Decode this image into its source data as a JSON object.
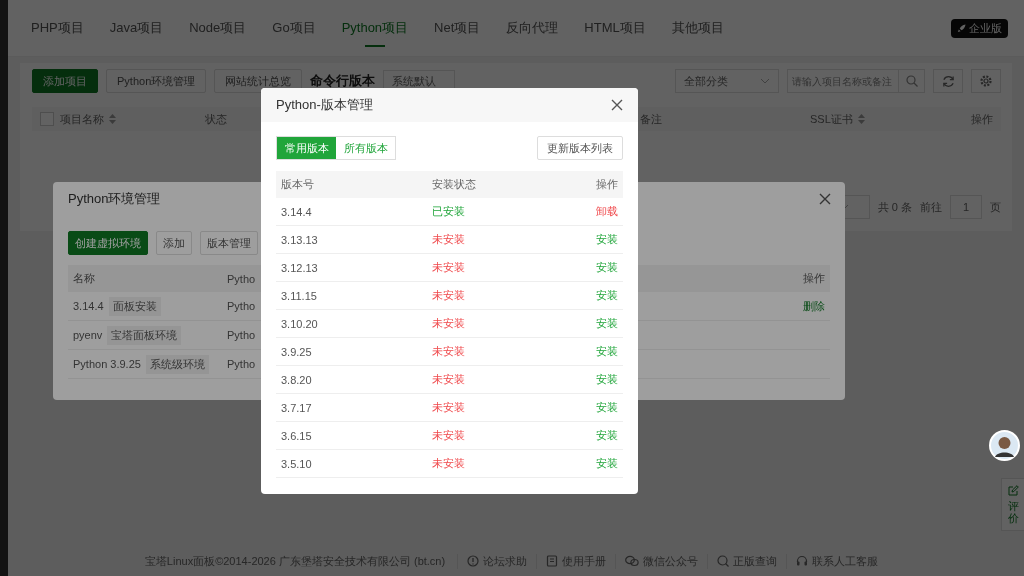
{
  "project_tabs": [
    {
      "label": "PHP项目",
      "selected": false
    },
    {
      "label": "Java项目",
      "selected": false
    },
    {
      "label": "Node项目",
      "selected": false
    },
    {
      "label": "Go项目",
      "selected": false
    },
    {
      "label": "Python项目",
      "selected": true
    },
    {
      "label": "Net项目",
      "selected": false
    },
    {
      "label": "反向代理",
      "selected": false
    },
    {
      "label": "HTML项目",
      "selected": false
    },
    {
      "label": "其他项目",
      "selected": false
    }
  ],
  "edition_badge": "企业版",
  "toolbar": {
    "buttons": [
      {
        "label": "添加项目",
        "kind": "primary"
      },
      {
        "label": "Python环境管理",
        "kind": "default"
      },
      {
        "label": "网站统计总览",
        "kind": "default"
      }
    ],
    "cli_version_label": "命令行版本",
    "cli_version_select": "系统默认",
    "category_select": "全部分类",
    "search": {
      "placeholder": "请输入项目名称或备注"
    }
  },
  "project_table": {
    "select_all": {
      "checked": false
    },
    "columns": [
      {
        "label": "项目名称",
        "sortable": true
      },
      {
        "label": "状态",
        "sortable": false
      },
      {
        "label": "备注",
        "sortable": false
      },
      {
        "label": "SSL证书",
        "sortable": true
      },
      {
        "label": "操作",
        "sortable": false
      }
    ]
  },
  "pagination": {
    "total": "共 0 条",
    "goto_label": "前往",
    "page": "1",
    "page_unit": "页"
  },
  "footer": {
    "copyright": "宝塔Linux面板©2014-2026 广东堡塔安全技术有限公司 (bt.cn)",
    "links": [
      {
        "label": "论坛求助"
      },
      {
        "label": "使用手册"
      },
      {
        "label": "微信公众号"
      },
      {
        "label": "正版查询"
      },
      {
        "label": "联系人工客服"
      }
    ]
  },
  "side_panel": {
    "items": [
      {
        "label": "评价"
      }
    ]
  },
  "env_dialog": {
    "title": "Python环境管理",
    "buttons": [
      {
        "label": "创建虚拟环境",
        "kind": "primary"
      },
      {
        "label": "添加",
        "kind": "default"
      },
      {
        "label": "版本管理",
        "kind": "default"
      }
    ],
    "columns": [
      "名称",
      "Pytho",
      "操作"
    ],
    "rows": [
      {
        "name": "3.14.4",
        "tag": "面板安装",
        "column_2": "Pytho",
        "action": "删除"
      },
      {
        "name": "pyenv",
        "tag": "宝塔面板环境",
        "column_2": "Pytho"
      },
      {
        "name": "Python 3.9.25",
        "tag": "系统级环境",
        "column_2": "Pytho"
      }
    ]
  },
  "version_dialog": {
    "title": "Python-版本管理",
    "tabs": [
      {
        "label": "常用版本",
        "selected": true
      },
      {
        "label": "所有版本",
        "selected": false
      }
    ],
    "refresh_button": "更新版本列表",
    "columns": [
      "版本号",
      "安装状态",
      "操作"
    ],
    "rows": [
      {
        "version": "3.14.4",
        "status": "已安装",
        "installed": true,
        "action": "卸载"
      },
      {
        "version": "3.13.13",
        "status": "未安装",
        "installed": false,
        "action": "安装"
      },
      {
        "version": "3.12.13",
        "status": "未安装",
        "installed": false,
        "action": "安装"
      },
      {
        "version": "3.11.15",
        "status": "未安装",
        "installed": false,
        "action": "安装"
      },
      {
        "version": "3.10.20",
        "status": "未安装",
        "installed": false,
        "action": "安装"
      },
      {
        "version": "3.9.25",
        "status": "未安装",
        "installed": false,
        "action": "安装"
      },
      {
        "version": "3.8.20",
        "status": "未安装",
        "installed": false,
        "action": "安装"
      },
      {
        "version": "3.7.17",
        "status": "未安装",
        "installed": false,
        "action": "安装"
      },
      {
        "version": "3.6.15",
        "status": "未安装",
        "installed": false,
        "action": "安装"
      },
      {
        "version": "3.5.10",
        "status": "未安装",
        "installed": false,
        "action": "安装"
      }
    ]
  }
}
